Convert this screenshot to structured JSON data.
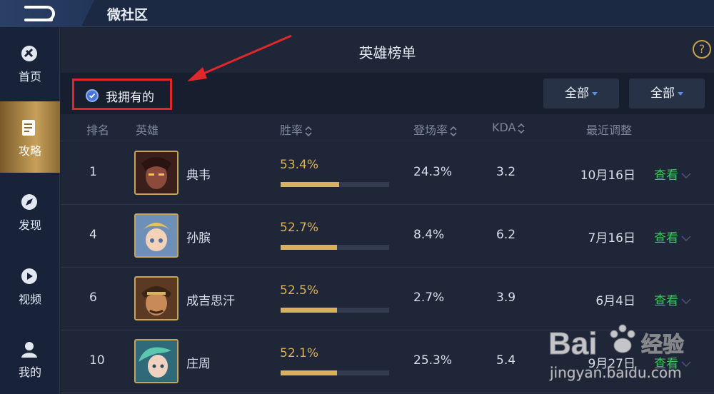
{
  "app": {
    "title": "微社区"
  },
  "sidebar": {
    "items": [
      {
        "label": "首页",
        "icon": "home-icon"
      },
      {
        "label": "攻略",
        "icon": "guide-icon",
        "active": true
      },
      {
        "label": "发现",
        "icon": "compass-icon"
      },
      {
        "label": "视频",
        "icon": "play-icon"
      },
      {
        "label": "我的",
        "icon": "user-icon"
      }
    ]
  },
  "page": {
    "title": "英雄榜单",
    "help_label": "?"
  },
  "filters": {
    "owned_label": "我拥有的",
    "owned_checked": true,
    "dropdown1": "全部",
    "dropdown2": "全部"
  },
  "table": {
    "headers": {
      "rank": "排名",
      "hero": "英雄",
      "winrate": "胜率",
      "pickrate": "登场率",
      "kda": "KDA",
      "updated": "最近调整"
    },
    "rows": [
      {
        "rank": "1",
        "hero": "典韦",
        "winrate": "53.4%",
        "winrate_fill": 0.54,
        "pickrate": "24.3%",
        "kda": "3.2",
        "updated": "10月16日",
        "action": "查看"
      },
      {
        "rank": "4",
        "hero": "孙膑",
        "winrate": "52.7%",
        "winrate_fill": 0.52,
        "pickrate": "8.4%",
        "kda": "6.2",
        "updated": "7月16日",
        "action": "查看"
      },
      {
        "rank": "6",
        "hero": "成吉思汗",
        "winrate": "52.5%",
        "winrate_fill": 0.52,
        "pickrate": "2.7%",
        "kda": "3.9",
        "updated": "6月4日",
        "action": "查看"
      },
      {
        "rank": "10",
        "hero": "庄周",
        "winrate": "52.1%",
        "winrate_fill": 0.52,
        "pickrate": "25.3%",
        "kda": "5.4",
        "updated": "9月27日",
        "action": "查看"
      }
    ]
  },
  "watermark": {
    "brand": "Bai",
    "brand2": "经验",
    "url": "jingyan.baidu.com"
  },
  "colors": {
    "accent_gold": "#d7b35e",
    "link_green": "#3fc266",
    "highlight_red": "#e0272b"
  }
}
